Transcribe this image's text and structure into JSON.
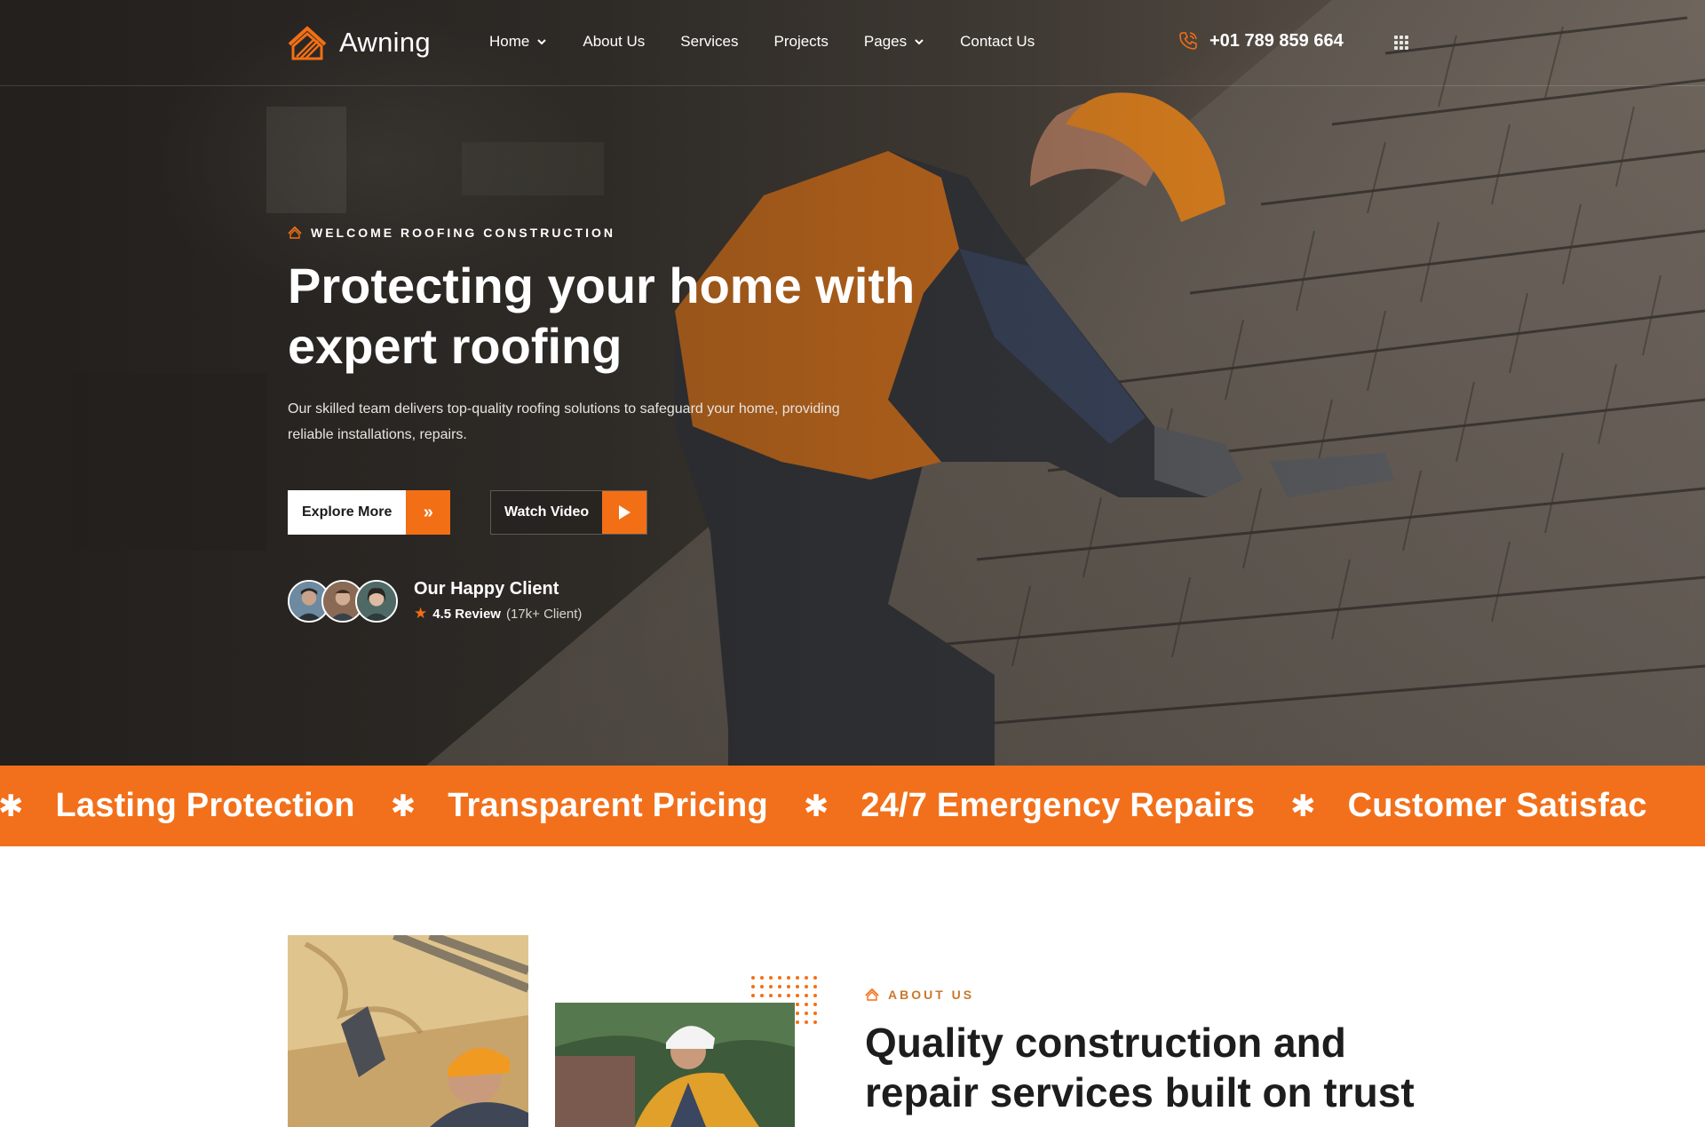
{
  "brand": {
    "name": "Awning",
    "accent": "#f26f16"
  },
  "nav": [
    {
      "label": "Home",
      "dropdown": true
    },
    {
      "label": "About Us",
      "dropdown": false
    },
    {
      "label": "Services",
      "dropdown": false
    },
    {
      "label": "Projects",
      "dropdown": false
    },
    {
      "label": "Pages",
      "dropdown": true
    },
    {
      "label": "Contact Us",
      "dropdown": false
    }
  ],
  "header": {
    "phone": "+01 789 859 664",
    "phone_icon": "phone-icon",
    "menu_icon": "grid-menu-icon"
  },
  "hero": {
    "eyebrow": "WELCOME ROOFING CONSTRUCTION",
    "title": "Protecting your home with expert roofing",
    "description": "Our skilled team delivers top-quality roofing solutions to safeguard your home, providing reliable installations, repairs.",
    "explore_label": "Explore More",
    "video_label": "Watch Video",
    "clients_title": "Our Happy Client",
    "review_score": "4.5 Review",
    "review_count": "(17k+ Client)"
  },
  "marquee": [
    "Lasting Protection",
    "Transparent Pricing",
    "24/7 Emergency Repairs",
    "Customer Satisfac"
  ],
  "about": {
    "eyebrow": "ABOUT US",
    "title": "Quality construction and repair services built on trust"
  }
}
